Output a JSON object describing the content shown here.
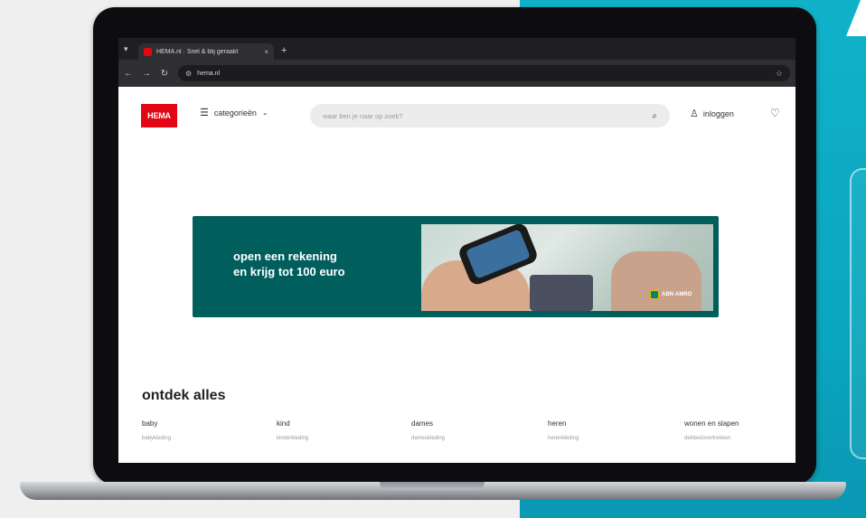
{
  "browser": {
    "tab_title": "HEMA.nl · Snel & blij geraakt",
    "tab_close": "×",
    "new_tab": "+",
    "url": "hema.nl"
  },
  "header": {
    "logo": "HEMA",
    "categories_label": "categorieën",
    "search_placeholder": "waar ben je naar op zoek?",
    "login_label": "inloggen"
  },
  "banner": {
    "line1": "open een rekening",
    "line2": "en krijg tot 100 euro",
    "partner": "ABN·AMRO"
  },
  "ontdek": {
    "title": "ontdek alles",
    "columns": [
      {
        "label": "baby",
        "sub": "babykleding"
      },
      {
        "label": "kind",
        "sub": "kinderkleding"
      },
      {
        "label": "dames",
        "sub": "dameskleding"
      },
      {
        "label": "heren",
        "sub": "herenkleding"
      },
      {
        "label": "wonen en slapen",
        "sub": "dekbedovertrekken"
      }
    ]
  },
  "colors": {
    "brand_red": "#e30613",
    "banner_green": "#005e5d",
    "teal_bg": "#11b2c9"
  },
  "icons": [
    "menu-icon",
    "chevron-down-icon",
    "search-icon",
    "user-icon",
    "heart-icon",
    "back-icon",
    "forward-icon",
    "reload-icon",
    "star-icon",
    "site-settings-icon"
  ]
}
